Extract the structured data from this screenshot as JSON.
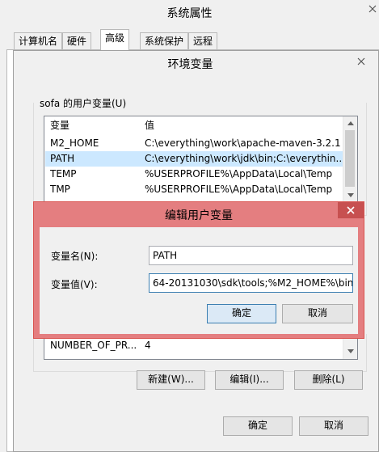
{
  "system_props": {
    "title": "系统属性",
    "tabs": [
      "计算机名",
      "硬件",
      "高级",
      "系统保护",
      "远程"
    ]
  },
  "env_vars": {
    "title": "环境变量",
    "user_group_label": "sofa 的用户变量(U)",
    "columns": [
      "变量",
      "值"
    ],
    "user_vars": [
      {
        "name": "M2_HOME",
        "value": "C:\\everything\\work\\apache-maven-3.2.1"
      },
      {
        "name": "PATH",
        "value": "C:\\everything\\work\\jdk\\bin;C:\\everythin..."
      },
      {
        "name": "TEMP",
        "value": "%USERPROFILE%\\AppData\\Local\\Temp"
      },
      {
        "name": "TMP",
        "value": "%USERPROFILE%\\AppData\\Local\\Temp"
      }
    ],
    "system_vars_visible": [
      {
        "name": "NUMBER_OF_PR...",
        "value": "4"
      }
    ],
    "buttons": {
      "new": "新建(W)...",
      "edit": "编辑(I)...",
      "delete": "删除(L)"
    },
    "ok": "确定",
    "cancel": "取消"
  },
  "edit_dialog": {
    "title": "编辑用户变量",
    "name_label": "变量名(N):",
    "name_value": "PATH",
    "value_label": "变量值(V):",
    "value_value": "64-20131030\\sdk\\tools;%M2_HOME%\\bin",
    "ok": "确定",
    "cancel": "取消"
  },
  "colors": {
    "edit_titlebar": "#e0787a",
    "edit_border": "#d9534f",
    "selected_row": "#cce8ff"
  }
}
